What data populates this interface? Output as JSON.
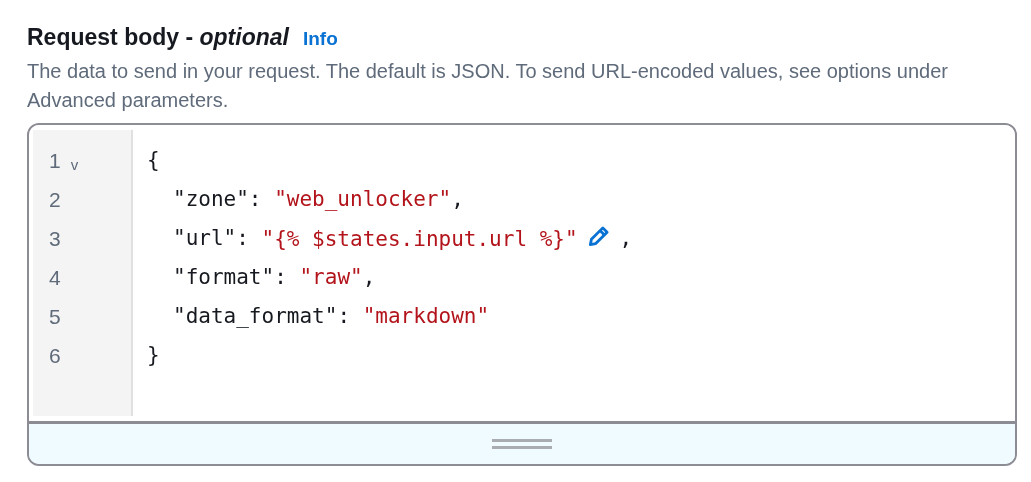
{
  "heading": {
    "title": "Request body - *optional*",
    "info_link": "Info"
  },
  "description": "The data to send in your request. The default is JSON. To send URL-encoded values, see options under Advanced parameters.",
  "editor": {
    "lines": [
      {
        "number": "1",
        "fold": "v",
        "indented": false,
        "tokens": [
          {
            "kind": "punct",
            "text": "{"
          }
        ]
      },
      {
        "number": "2",
        "indented": true,
        "tokens": [
          {
            "kind": "key",
            "text": "\"zone\""
          },
          {
            "kind": "punct",
            "text": ": "
          },
          {
            "kind": "string",
            "text": "\"web_unlocker\"",
            "editable": false
          },
          {
            "kind": "punct",
            "text": ","
          }
        ]
      },
      {
        "number": "3",
        "indented": true,
        "tokens": [
          {
            "kind": "key",
            "text": "\"url\""
          },
          {
            "kind": "punct",
            "text": ": "
          },
          {
            "kind": "string",
            "text": "\"{% $states.input.url %}\"",
            "editable": true
          },
          {
            "kind": "punct",
            "text": ","
          }
        ]
      },
      {
        "number": "4",
        "indented": true,
        "tokens": [
          {
            "kind": "key",
            "text": "\"format\""
          },
          {
            "kind": "punct",
            "text": ": "
          },
          {
            "kind": "string",
            "text": "\"raw\"",
            "editable": false
          },
          {
            "kind": "punct",
            "text": ","
          }
        ]
      },
      {
        "number": "5",
        "indented": true,
        "tokens": [
          {
            "kind": "key",
            "text": "\"data_format\""
          },
          {
            "kind": "punct",
            "text": ": "
          },
          {
            "kind": "string",
            "text": "\"markdown\"",
            "editable": false
          }
        ]
      },
      {
        "number": "6",
        "indented": false,
        "tokens": [
          {
            "kind": "punct",
            "text": "}"
          }
        ]
      }
    ]
  }
}
